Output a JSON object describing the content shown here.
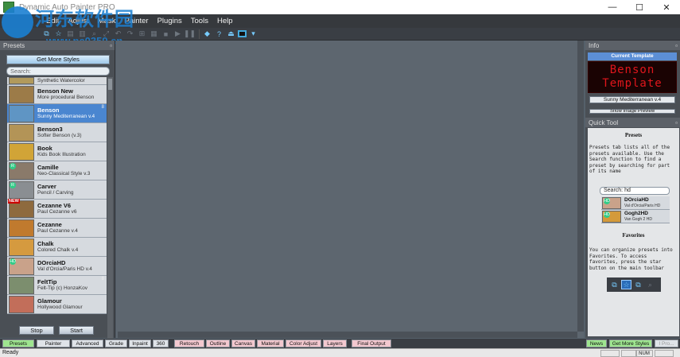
{
  "window": {
    "title": "Dynamic Auto Painter PRO",
    "minimize": "—",
    "maximize": "☐",
    "close": "✕"
  },
  "watermark": {
    "line1": "河东软件园",
    "line2": "www.pc0359.cn"
  },
  "menu": [
    "File",
    "Edit",
    "Adjust",
    "Mask",
    "Painter",
    "Plugins",
    "Tools",
    "Help"
  ],
  "left_panel": {
    "header": "Presets",
    "get_more_styles": "Get More Styles",
    "search_placeholder": "Search:",
    "presets": [
      {
        "name": "",
        "subtitle": "Synthetic Watercolor",
        "thumb": "#b29a5c",
        "partial": true
      },
      {
        "name": "Benson New",
        "subtitle": "More procedural Benson",
        "thumb": "#9c7b48"
      },
      {
        "name": "Benson",
        "subtitle": "Sunny Mediterranean v.4",
        "thumb": "#5f95c4",
        "selected": true,
        "num": "8"
      },
      {
        "name": "Benson3",
        "subtitle": "Softer Benson (v.3)",
        "thumb": "#b39457"
      },
      {
        "name": "Book",
        "subtitle": "Kids Book Illustration",
        "thumb": "#d1a437"
      },
      {
        "name": "Camille",
        "subtitle": "Neo-Classical Style v.3",
        "thumb": "#8a7a6a",
        "badge": "R",
        "arrow": true
      },
      {
        "name": "Carver",
        "subtitle": "Pencil / Carving",
        "thumb": "#8a8e92",
        "badge": "R"
      },
      {
        "name": "Cezanne V6",
        "subtitle": "Paul Cezanne v6",
        "thumb": "#8e6a3e",
        "new": "NEW",
        "arrow": true
      },
      {
        "name": "Cezanne",
        "subtitle": "Paul Cezanne v.4",
        "thumb": "#c07a2e",
        "arrow": true
      },
      {
        "name": "Chalk",
        "subtitle": "Colored Chalk v.4",
        "thumb": "#d59a3f",
        "arrow": true
      },
      {
        "name": "DOrciaHD",
        "subtitle": "Val d'Orcia/Paris HD v.4",
        "thumb": "#c9a28a",
        "badge": "HD"
      },
      {
        "name": "FeltTip",
        "subtitle": "Felt-Tip (c) HonzaKov",
        "thumb": "#7c8e6e",
        "arrow": true,
        "num": "8"
      },
      {
        "name": "Glamour",
        "subtitle": "Hollywood Glamour",
        "thumb": "#c26e5a",
        "arrow": true
      }
    ],
    "stop": "Stop",
    "start": "Start"
  },
  "right_panel": {
    "info_header": "Info",
    "current_template": "Current Template",
    "led_line1": "Benson",
    "led_line2": "Template",
    "template_button": "Sunny Mediterranean v.4",
    "show_button": "Show Image Preview",
    "quick_tool_header": "Quick Tool",
    "presets_heading": "Presets",
    "presets_text": "Presets tab lists all of the presets available. Use the Search function to find a preset by searching for part of its name",
    "search_value": "Search:  hd",
    "results": [
      {
        "name": "DOrciaHD",
        "subtitle": "Val d'Orcia/Paris HD",
        "thumb": "#c9a28a",
        "badge": "HD"
      },
      {
        "name": "Gogh2HD",
        "subtitle": "Van Gogh 2 HD",
        "thumb": "#d49a3a",
        "badge": "HD"
      }
    ],
    "favorites_heading": "Favorites",
    "favorites_text": "You can organize presets into Favorites. To access favorites, press the star button on the main toolbar"
  },
  "tabs_left": [
    "Presets",
    "Painter",
    "Advanced",
    "Grade",
    "Inpaint",
    "360",
    "Retouch",
    "Outline",
    "Canvas",
    "Material",
    "Color Adjust",
    "Layers",
    "Final Output"
  ],
  "tabs_right": [
    "News",
    "Get More Styles",
    "I Pro..."
  ],
  "status": {
    "ready": "Ready",
    "num": "NUM"
  }
}
